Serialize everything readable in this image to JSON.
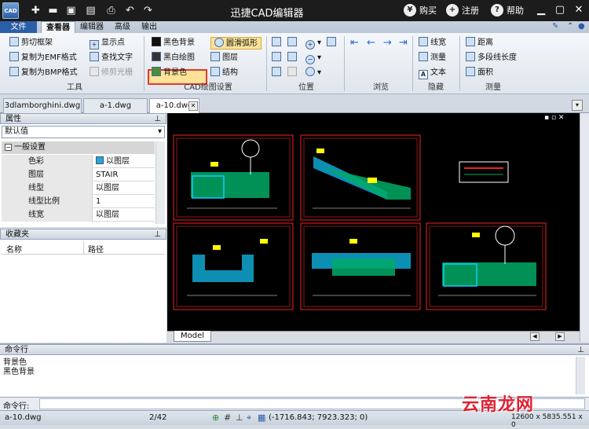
{
  "titlebar": {
    "app_icon": "CAD",
    "title": "迅捷CAD编辑器",
    "buy": "购买",
    "register": "注册",
    "help": "帮助"
  },
  "menu": {
    "file": "文件",
    "tabs": [
      "查看器",
      "编辑器",
      "高级",
      "输出"
    ]
  },
  "ribbon": {
    "tools": {
      "items": [
        "剪切框架",
        "复制为EMF格式",
        "复制为BMP格式",
        "显示点",
        "查找文字",
        "修剪光栅"
      ],
      "label": "工具"
    },
    "cad_settings": {
      "black_bg": "黑色背景",
      "bw_drawing": "黑白绘图",
      "bg_color": "背景色",
      "smooth_arc": "圆滑弧形",
      "layers": "图层",
      "structure": "结构",
      "label": "CAD绘图设置"
    },
    "position": {
      "label": "位置"
    },
    "browse": {
      "label": "浏览"
    },
    "hide": {
      "items": [
        "线宽",
        "测量",
        "文本"
      ],
      "label": "隐藏"
    },
    "measure": {
      "items": [
        "距离",
        "多段线长度",
        "面积"
      ],
      "label": "测量"
    }
  },
  "doc_tabs": [
    "3dlamborghini.dwg",
    "a-1.dwg",
    "a-10.dwg"
  ],
  "properties": {
    "header": "属性",
    "select": "默认值",
    "section": "一般设置",
    "rows": [
      {
        "k": "色彩",
        "v": "以图层"
      },
      {
        "k": "图层",
        "v": "STAIR"
      },
      {
        "k": "线型",
        "v": "以图层"
      },
      {
        "k": "线型比例",
        "v": "1"
      },
      {
        "k": "线宽",
        "v": "以图层"
      }
    ]
  },
  "favorites": {
    "header": "收藏夹",
    "col_name": "名称",
    "col_path": "路径"
  },
  "model_tab": "Model",
  "command": {
    "header": "命令行",
    "history": [
      "背景色",
      "黑色背景"
    ],
    "prompt": "命令行:"
  },
  "status": {
    "file": "a-10.dwg",
    "page": "2/42",
    "coords": "(-1716.843; 7923.323; 0)",
    "size": "12600 x 5835.551 x 0"
  },
  "watermark": "云南龙网",
  "colors": {
    "accent": "#2c5ea8",
    "highlight": "#fbe39a",
    "frame": "#e53a2a"
  }
}
